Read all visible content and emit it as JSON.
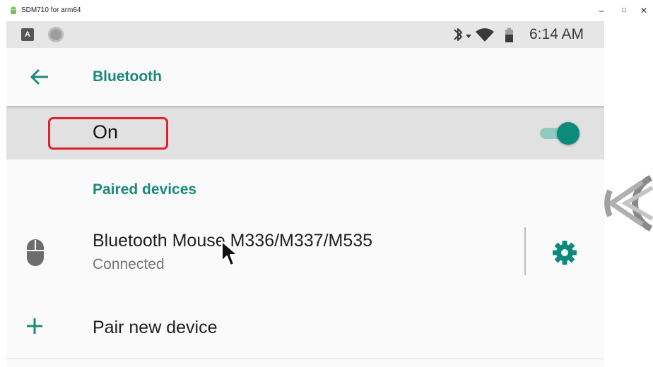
{
  "window": {
    "title": "SDM710 for arm64",
    "minimize": "–",
    "maximize": "□",
    "close": "✕",
    "app_icon": "android-icon"
  },
  "statusbar": {
    "badge": "A",
    "icons": [
      "bluetooth-icon",
      "wifi-icon",
      "battery-icon"
    ],
    "time": "6:14 AM"
  },
  "appbar": {
    "back_icon": "arrow-left-icon",
    "title": "Bluetooth"
  },
  "bluetooth_toggle": {
    "label": "On",
    "state": "on"
  },
  "paired_devices": {
    "title": "Paired devices",
    "devices": [
      {
        "icon": "mouse-icon",
        "name": "Bluetooth Mouse M336/M337/M535",
        "status": "Connected",
        "settings_icon": "gear-icon"
      }
    ]
  },
  "pair_new": {
    "icon": "plus-icon",
    "label": "Pair new device"
  },
  "colors": {
    "accent": "#1b8a7d",
    "toggle_thumb": "#0c8a7b",
    "toggle_track": "#8fc9c2",
    "highlight": "#e0202a",
    "status_bar": "#e6e6e6",
    "on_bar": "#e1e1e1"
  }
}
